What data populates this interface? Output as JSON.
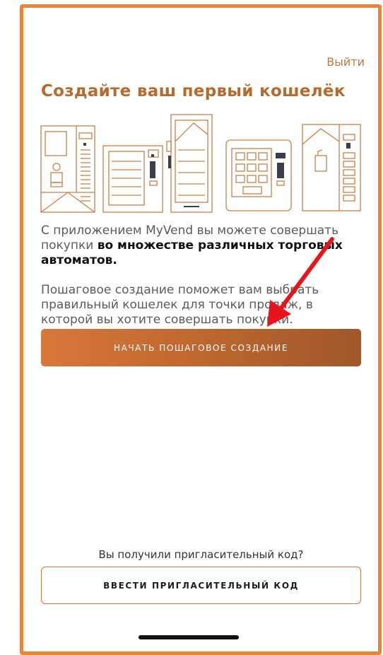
{
  "header": {
    "logout_label": "Выйти"
  },
  "title": "Создайте ваш первый кошелёк",
  "illustration": {
    "name": "vending-machines-illustration",
    "line_color": "#c9804a",
    "dark_color": "#3a3f4a"
  },
  "description": {
    "p1_text": "С приложением MyVend вы можете совершать покупки ",
    "p1_bold": "во множестве различных торговых автоматов.",
    "p2": "Пошаговое создание поможет вам выбрать правильный кошелек для точки продаж, в которой вы хотите совершать покупки."
  },
  "primary_button": {
    "label": "НАЧАТЬ ПОШАГОВОЕ СОЗДАНИЕ"
  },
  "invite": {
    "question": "Вы получили пригласительный код?",
    "button_label": "ВВЕСТИ ПРИГЛАСИТЕЛЬНЫЙ КОД"
  },
  "colors": {
    "accent": "#b86a2e",
    "frame": "#e9843a",
    "button_gradient_start": "#d9773b",
    "button_gradient_end": "#a0572a",
    "annotation_arrow": "#e8141c"
  }
}
